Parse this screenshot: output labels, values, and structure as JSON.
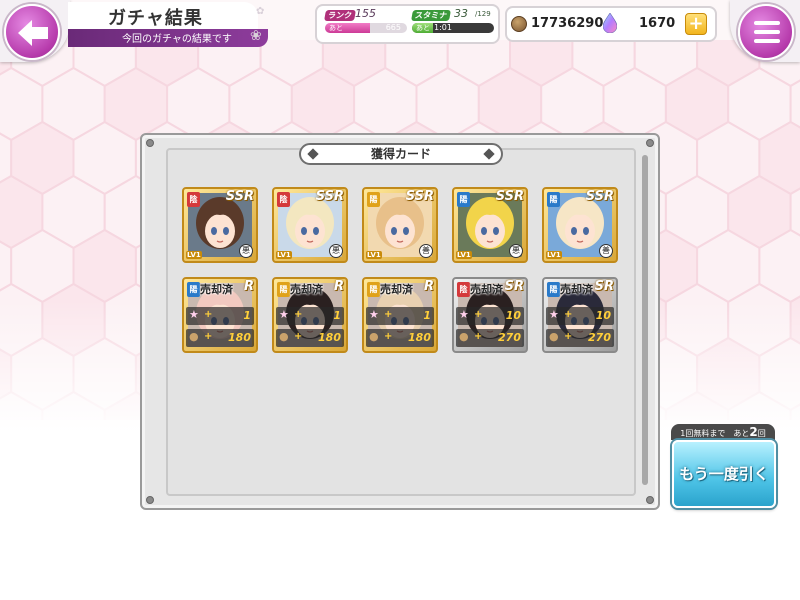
{
  "header": {
    "title": "ガチャ結果",
    "subtitle": "今回のガチャの結果です"
  },
  "status": {
    "rank_label": "ランク",
    "rank": "155",
    "rank_remain_prefix": "あと",
    "rank_remain": "665",
    "rank_progress": 0.55,
    "stamina_label": "スタミナ",
    "stamina": "33",
    "stamina_max": "/129",
    "stamina_remain_prefix": "あと",
    "stamina_time": "1:01",
    "stamina_progress": 0.26
  },
  "currency": {
    "coins": "17736290",
    "gems": "1670",
    "plus_label": "+"
  },
  "panel": {
    "title": "獲得カード"
  },
  "cards_row1": [
    {
      "rarity": "SSR",
      "attr": "陰",
      "attr_color": "#d4393b",
      "badge": "悪",
      "lv": "LV1",
      "hair": "#5a3a2a",
      "bg": "#6a7a8a"
    },
    {
      "rarity": "SSR",
      "attr": "陰",
      "attr_color": "#d4393b",
      "badge": "悪",
      "lv": "LV1",
      "hair": "#f3e7c0",
      "bg": "#c9d9e9"
    },
    {
      "rarity": "SSR",
      "attr": "陽",
      "attr_color": "#e0a21a",
      "badge": "善",
      "lv": "LV1",
      "hair": "#e8c08a",
      "bg": "#f2d9b0"
    },
    {
      "rarity": "SSR",
      "attr": "陽",
      "attr_color": "#2a7ac9",
      "badge": "悪",
      "lv": "LV1",
      "hair": "#f2d44a",
      "bg": "#6a7a5a"
    },
    {
      "rarity": "SSR",
      "attr": "陽",
      "attr_color": "#2a7ac9",
      "badge": "善",
      "lv": "LV1",
      "hair": "#f6e6c6",
      "bg": "#7aa9d9"
    }
  ],
  "cards_row2": [
    {
      "rarity": "R",
      "attr": "陽",
      "attr_color": "#2a7ac9",
      "sold": "売却済",
      "star_count": "1",
      "coin_count": "180",
      "hair": "#f2c9c0",
      "silver": false
    },
    {
      "rarity": "R",
      "attr": "陽",
      "attr_color": "#e0a21a",
      "sold": "売却済",
      "star_count": "1",
      "coin_count": "180",
      "hair": "#2a2020",
      "silver": false
    },
    {
      "rarity": "R",
      "attr": "陽",
      "attr_color": "#e0a21a",
      "sold": "売却済",
      "star_count": "1",
      "coin_count": "180",
      "hair": "#e8d0b0",
      "silver": false
    },
    {
      "rarity": "SR",
      "attr": "陰",
      "attr_color": "#d4393b",
      "sold": "売却済",
      "star_count": "10",
      "coin_count": "270",
      "hair": "#2a2020",
      "silver": true
    },
    {
      "rarity": "SR",
      "attr": "陽",
      "attr_color": "#2a7ac9",
      "sold": "売却済",
      "star_count": "10",
      "coin_count": "270",
      "hair": "#2a2a3a",
      "silver": true
    }
  ],
  "sold_plus": "+",
  "draw_again": {
    "remain_prefix": "1回無料まで　あと",
    "remain_count": "2",
    "remain_suffix": "回",
    "button_label": "もう一度引く"
  }
}
